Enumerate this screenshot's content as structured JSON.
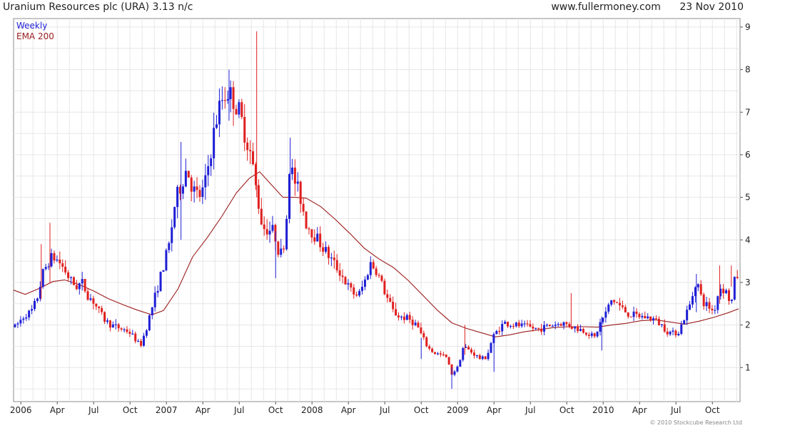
{
  "header": {
    "title": "Uranium Resources plc (URA) 3.13 n/c",
    "site": "www.fullermoney.com",
    "date": "23 Nov 2010"
  },
  "footer": {
    "copyright": "© 2010 Stockcube Research Ltd"
  },
  "colors": {
    "up": "#1f1fd6",
    "down": "#e01f1f",
    "ema": "#9b1c1c",
    "grid": "#e6e6e6",
    "weekly_label": "#1f1fd6",
    "ema_label": "#9b1c1c"
  },
  "chart_data": {
    "type": "candlestick",
    "interval": "Weekly",
    "legend": [
      "Weekly",
      "EMA 200"
    ],
    "legend_position": "top-left",
    "y_axis_side": "right",
    "grid": true,
    "ylim": [
      0.2,
      9.2
    ],
    "yticks": [
      1,
      2,
      3,
      4,
      5,
      6,
      7,
      8,
      9
    ],
    "xlim": [
      2005.95,
      2010.94
    ],
    "xticks": [
      {
        "label": "2006",
        "t": 2006.0
      },
      {
        "label": "Apr",
        "t": 2006.25
      },
      {
        "label": "Jul",
        "t": 2006.5
      },
      {
        "label": "Oct",
        "t": 2006.75
      },
      {
        "label": "2007",
        "t": 2007.0
      },
      {
        "label": "Apr",
        "t": 2007.25
      },
      {
        "label": "Jul",
        "t": 2007.5
      },
      {
        "label": "Oct",
        "t": 2007.75
      },
      {
        "label": "2008",
        "t": 2008.0
      },
      {
        "label": "Apr",
        "t": 2008.25
      },
      {
        "label": "Jul",
        "t": 2008.5
      },
      {
        "label": "Oct",
        "t": 2008.75
      },
      {
        "label": "2009",
        "t": 2009.0
      },
      {
        "label": "Apr",
        "t": 2009.25
      },
      {
        "label": "Jul",
        "t": 2009.5
      },
      {
        "label": "Oct",
        "t": 2009.75
      },
      {
        "label": "2010",
        "t": 2010.0
      },
      {
        "label": "Apr",
        "t": 2010.25
      },
      {
        "label": "Jul",
        "t": 2010.5
      },
      {
        "label": "Oct",
        "t": 2010.75
      }
    ],
    "close_path": [
      [
        2005.96,
        1.95
      ],
      [
        2006.03,
        2.25
      ],
      [
        2006.07,
        2.3
      ],
      [
        2006.11,
        2.6
      ],
      [
        2006.15,
        3.2
      ],
      [
        2006.19,
        3.5
      ],
      [
        2006.22,
        3.6
      ],
      [
        2006.26,
        3.5
      ],
      [
        2006.3,
        3.3
      ],
      [
        2006.34,
        3.05
      ],
      [
        2006.38,
        2.9
      ],
      [
        2006.42,
        3.0
      ],
      [
        2006.46,
        2.7
      ],
      [
        2006.5,
        2.55
      ],
      [
        2006.54,
        2.3
      ],
      [
        2006.58,
        2.1
      ],
      [
        2006.62,
        2.0
      ],
      [
        2006.66,
        1.95
      ],
      [
        2006.7,
        1.9
      ],
      [
        2006.74,
        1.85
      ],
      [
        2006.78,
        1.7
      ],
      [
        2006.82,
        1.5
      ],
      [
        2006.86,
        1.9
      ],
      [
        2006.9,
        2.4
      ],
      [
        2006.94,
        2.9
      ],
      [
        2006.98,
        3.4
      ],
      [
        2007.02,
        3.9
      ],
      [
        2007.06,
        4.9
      ],
      [
        2007.1,
        5.3
      ],
      [
        2007.14,
        5.7
      ],
      [
        2007.18,
        5.2
      ],
      [
        2007.22,
        5.0
      ],
      [
        2007.26,
        5.2
      ],
      [
        2007.3,
        6.0
      ],
      [
        2007.34,
        6.8
      ],
      [
        2007.38,
        7.3
      ],
      [
        2007.42,
        7.5
      ],
      [
        2007.46,
        7.3
      ],
      [
        2007.5,
        7.0
      ],
      [
        2007.54,
        6.5
      ],
      [
        2007.58,
        6.0
      ],
      [
        2007.62,
        5.1
      ],
      [
        2007.66,
        4.3
      ],
      [
        2007.7,
        4.25
      ],
      [
        2007.74,
        4.2
      ],
      [
        2007.78,
        3.6
      ],
      [
        2007.82,
        4.1
      ],
      [
        2007.84,
        5.8
      ],
      [
        2007.88,
        5.4
      ],
      [
        2007.92,
        5.0
      ],
      [
        2007.96,
        4.4
      ],
      [
        2008.0,
        4.2
      ],
      [
        2008.04,
        4.0
      ],
      [
        2008.08,
        3.8
      ],
      [
        2008.12,
        3.6
      ],
      [
        2008.16,
        3.4
      ],
      [
        2008.2,
        3.2
      ],
      [
        2008.24,
        2.95
      ],
      [
        2008.28,
        2.75
      ],
      [
        2008.32,
        2.7
      ],
      [
        2008.36,
        3.0
      ],
      [
        2008.4,
        3.45
      ],
      [
        2008.44,
        3.3
      ],
      [
        2008.48,
        2.95
      ],
      [
        2008.52,
        2.6
      ],
      [
        2008.56,
        2.3
      ],
      [
        2008.6,
        2.2
      ],
      [
        2008.66,
        2.15
      ],
      [
        2008.72,
        2.0
      ],
      [
        2008.76,
        1.7
      ],
      [
        2008.8,
        1.45
      ],
      [
        2008.84,
        1.35
      ],
      [
        2008.88,
        1.3
      ],
      [
        2008.92,
        1.25
      ],
      [
        2008.96,
        0.85
      ],
      [
        2009.0,
        1.0
      ],
      [
        2009.04,
        1.5
      ],
      [
        2009.08,
        1.4
      ],
      [
        2009.12,
        1.3
      ],
      [
        2009.16,
        1.2
      ],
      [
        2009.2,
        1.25
      ],
      [
        2009.24,
        1.7
      ],
      [
        2009.28,
        1.9
      ],
      [
        2009.32,
        2.05
      ],
      [
        2009.4,
        2.0
      ],
      [
        2009.48,
        1.95
      ],
      [
        2009.56,
        1.9
      ],
      [
        2009.64,
        2.0
      ],
      [
        2009.72,
        2.05
      ],
      [
        2009.8,
        1.95
      ],
      [
        2009.88,
        1.85
      ],
      [
        2009.94,
        1.7
      ],
      [
        2009.98,
        2.05
      ],
      [
        2010.02,
        2.3
      ],
      [
        2010.06,
        2.6
      ],
      [
        2010.1,
        2.5
      ],
      [
        2010.14,
        2.35
      ],
      [
        2010.18,
        2.25
      ],
      [
        2010.26,
        2.2
      ],
      [
        2010.34,
        2.15
      ],
      [
        2010.4,
        2.0
      ],
      [
        2010.44,
        1.85
      ],
      [
        2010.48,
        1.8
      ],
      [
        2010.52,
        1.85
      ],
      [
        2010.56,
        2.2
      ],
      [
        2010.6,
        2.5
      ],
      [
        2010.64,
        3.1
      ],
      [
        2010.68,
        2.55
      ],
      [
        2010.72,
        2.45
      ],
      [
        2010.76,
        2.3
      ],
      [
        2010.8,
        2.9
      ],
      [
        2010.84,
        2.8
      ],
      [
        2010.88,
        2.5
      ],
      [
        2010.91,
        3.2
      ],
      [
        2010.93,
        3.13
      ]
    ],
    "wick_spikes": [
      {
        "t": 2006.14,
        "low": 2.6,
        "high": 3.9
      },
      {
        "t": 2006.2,
        "low": 3.0,
        "high": 4.4
      },
      {
        "t": 2007.1,
        "low": 4.0,
        "high": 6.3
      },
      {
        "t": 2007.43,
        "low": 6.8,
        "high": 8.0
      },
      {
        "t": 2007.62,
        "low": 5.0,
        "high": 8.9
      },
      {
        "t": 2007.75,
        "low": 3.1,
        "high": 4.2
      },
      {
        "t": 2007.85,
        "low": 4.5,
        "high": 6.4
      },
      {
        "t": 2008.75,
        "low": 1.2,
        "high": 1.7
      },
      {
        "t": 2008.96,
        "low": 0.5,
        "high": 1.0
      },
      {
        "t": 2009.05,
        "low": 1.3,
        "high": 2.0
      },
      {
        "t": 2009.25,
        "low": 0.9,
        "high": 1.7
      },
      {
        "t": 2009.78,
        "low": 1.9,
        "high": 2.75
      },
      {
        "t": 2009.99,
        "low": 1.4,
        "high": 2.2
      },
      {
        "t": 2010.64,
        "low": 2.3,
        "high": 3.2
      },
      {
        "t": 2010.8,
        "low": 2.5,
        "high": 3.4
      },
      {
        "t": 2010.88,
        "low": 2.9,
        "high": 3.4
      }
    ],
    "ema200": [
      [
        2005.95,
        2.82
      ],
      [
        2006.03,
        2.72
      ],
      [
        2006.12,
        2.85
      ],
      [
        2006.22,
        3.02
      ],
      [
        2006.3,
        3.06
      ],
      [
        2006.4,
        2.95
      ],
      [
        2006.5,
        2.8
      ],
      [
        2006.6,
        2.62
      ],
      [
        2006.7,
        2.48
      ],
      [
        2006.8,
        2.35
      ],
      [
        2006.9,
        2.24
      ],
      [
        2006.98,
        2.34
      ],
      [
        2007.08,
        2.85
      ],
      [
        2007.18,
        3.6
      ],
      [
        2007.28,
        4.05
      ],
      [
        2007.38,
        4.55
      ],
      [
        2007.48,
        5.1
      ],
      [
        2007.57,
        5.45
      ],
      [
        2007.64,
        5.6
      ],
      [
        2007.72,
        5.3
      ],
      [
        2007.8,
        5.0
      ],
      [
        2007.88,
        5.0
      ],
      [
        2007.96,
        4.98
      ],
      [
        2008.06,
        4.78
      ],
      [
        2008.16,
        4.48
      ],
      [
        2008.26,
        4.15
      ],
      [
        2008.36,
        3.8
      ],
      [
        2008.46,
        3.55
      ],
      [
        2008.56,
        3.35
      ],
      [
        2008.66,
        3.05
      ],
      [
        2008.76,
        2.7
      ],
      [
        2008.86,
        2.35
      ],
      [
        2008.96,
        2.05
      ],
      [
        2009.06,
        1.92
      ],
      [
        2009.16,
        1.82
      ],
      [
        2009.26,
        1.72
      ],
      [
        2009.36,
        1.77
      ],
      [
        2009.46,
        1.84
      ],
      [
        2009.56,
        1.89
      ],
      [
        2009.66,
        1.94
      ],
      [
        2009.76,
        1.96
      ],
      [
        2009.86,
        1.96
      ],
      [
        2009.96,
        1.95
      ],
      [
        2010.06,
        2.0
      ],
      [
        2010.16,
        2.04
      ],
      [
        2010.26,
        2.1
      ],
      [
        2010.36,
        2.12
      ],
      [
        2010.46,
        2.07
      ],
      [
        2010.56,
        2.02
      ],
      [
        2010.66,
        2.09
      ],
      [
        2010.76,
        2.18
      ],
      [
        2010.86,
        2.29
      ],
      [
        2010.93,
        2.38
      ]
    ]
  }
}
